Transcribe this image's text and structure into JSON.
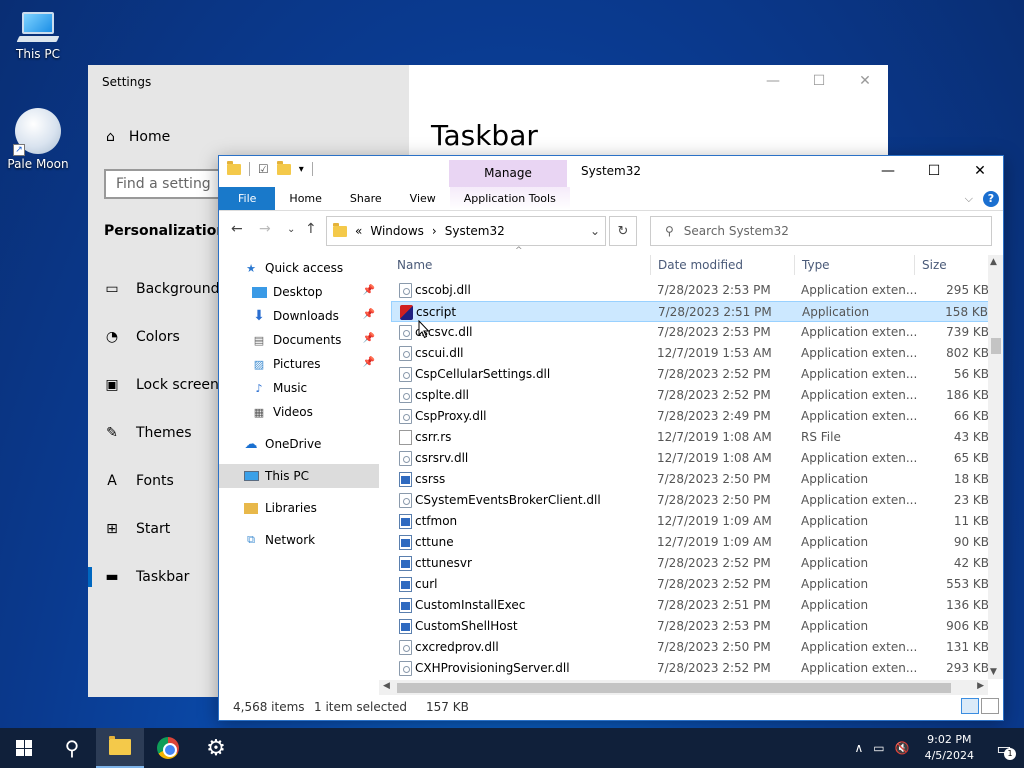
{
  "desktop": {
    "icons": [
      {
        "label": "This PC",
        "icon": "computer-icon"
      },
      {
        "label": "Pale Moon",
        "icon": "pale-moon-icon"
      }
    ]
  },
  "settings": {
    "title": "Settings",
    "home": "Home",
    "search_placeholder": "Find a setting",
    "section": "Personalization",
    "page_title": "Taskbar",
    "nav": [
      {
        "label": "Background",
        "icon": "image-icon"
      },
      {
        "label": "Colors",
        "icon": "palette-icon"
      },
      {
        "label": "Lock screen",
        "icon": "lock-screen-icon"
      },
      {
        "label": "Themes",
        "icon": "themes-icon"
      },
      {
        "label": "Fonts",
        "icon": "fonts-icon"
      },
      {
        "label": "Start",
        "icon": "start-icon"
      },
      {
        "label": "Taskbar",
        "icon": "taskbar-icon",
        "active": true
      }
    ]
  },
  "explorer": {
    "title": "System32",
    "manage": "Manage",
    "tabs": [
      "File",
      "Home",
      "Share",
      "View",
      "Application Tools"
    ],
    "address": {
      "prefix": "«",
      "crumbs": [
        "Windows",
        "System32"
      ]
    },
    "search_placeholder": "Search System32",
    "nav": {
      "quick_access": "Quick access",
      "pinned": [
        "Desktop",
        "Downloads",
        "Documents",
        "Pictures"
      ],
      "unpinned": [
        "Music",
        "Videos"
      ],
      "onedrive": "OneDrive",
      "this_pc": "This PC",
      "libraries": "Libraries",
      "network": "Network"
    },
    "columns": [
      "Name",
      "Date modified",
      "Type",
      "Size"
    ],
    "files": [
      {
        "name": "cscobj.dll",
        "date": "7/28/2023 2:53 PM",
        "type": "Application exten...",
        "size": "295 KB",
        "kind": "dll"
      },
      {
        "name": "cscript",
        "date": "7/28/2023 2:51 PM",
        "type": "Application",
        "size": "158 KB",
        "kind": "special",
        "selected": true
      },
      {
        "name": "cscsvc.dll",
        "date": "7/28/2023 2:53 PM",
        "type": "Application exten...",
        "size": "739 KB",
        "kind": "dll"
      },
      {
        "name": "cscui.dll",
        "date": "12/7/2019 1:53 AM",
        "type": "Application exten...",
        "size": "802 KB",
        "kind": "dll"
      },
      {
        "name": "CspCellularSettings.dll",
        "date": "7/28/2023 2:52 PM",
        "type": "Application exten...",
        "size": "56 KB",
        "kind": "dll"
      },
      {
        "name": "csplte.dll",
        "date": "7/28/2023 2:52 PM",
        "type": "Application exten...",
        "size": "186 KB",
        "kind": "dll"
      },
      {
        "name": "CspProxy.dll",
        "date": "7/28/2023 2:49 PM",
        "type": "Application exten...",
        "size": "66 KB",
        "kind": "dll"
      },
      {
        "name": "csrr.rs",
        "date": "12/7/2019 1:08 AM",
        "type": "RS File",
        "size": "43 KB",
        "kind": "doc"
      },
      {
        "name": "csrsrv.dll",
        "date": "12/7/2019 1:08 AM",
        "type": "Application exten...",
        "size": "65 KB",
        "kind": "dll"
      },
      {
        "name": "csrss",
        "date": "7/28/2023 2:50 PM",
        "type": "Application",
        "size": "18 KB",
        "kind": "exe"
      },
      {
        "name": "CSystemEventsBrokerClient.dll",
        "date": "7/28/2023 2:50 PM",
        "type": "Application exten...",
        "size": "23 KB",
        "kind": "dll"
      },
      {
        "name": "ctfmon",
        "date": "12/7/2019 1:09 AM",
        "type": "Application",
        "size": "11 KB",
        "kind": "exe"
      },
      {
        "name": "cttune",
        "date": "12/7/2019 1:09 AM",
        "type": "Application",
        "size": "90 KB",
        "kind": "exe"
      },
      {
        "name": "cttunesvr",
        "date": "7/28/2023 2:52 PM",
        "type": "Application",
        "size": "42 KB",
        "kind": "exe"
      },
      {
        "name": "curl",
        "date": "7/28/2023 2:52 PM",
        "type": "Application",
        "size": "553 KB",
        "kind": "exe"
      },
      {
        "name": "CustomInstallExec",
        "date": "7/28/2023 2:51 PM",
        "type": "Application",
        "size": "136 KB",
        "kind": "exe"
      },
      {
        "name": "CustomShellHost",
        "date": "7/28/2023 2:53 PM",
        "type": "Application",
        "size": "906 KB",
        "kind": "exe"
      },
      {
        "name": "cxcredprov.dll",
        "date": "7/28/2023 2:50 PM",
        "type": "Application exten...",
        "size": "131 KB",
        "kind": "dll"
      },
      {
        "name": "CXHProvisioningServer.dll",
        "date": "7/28/2023 2:52 PM",
        "type": "Application exten...",
        "size": "293 KB",
        "kind": "dll"
      }
    ],
    "status": {
      "items": "4,568 items",
      "selected": "1 item selected",
      "size": "157 KB"
    }
  },
  "taskbar": {
    "time": "9:02 PM",
    "date": "4/5/2024",
    "notifications": "1"
  }
}
